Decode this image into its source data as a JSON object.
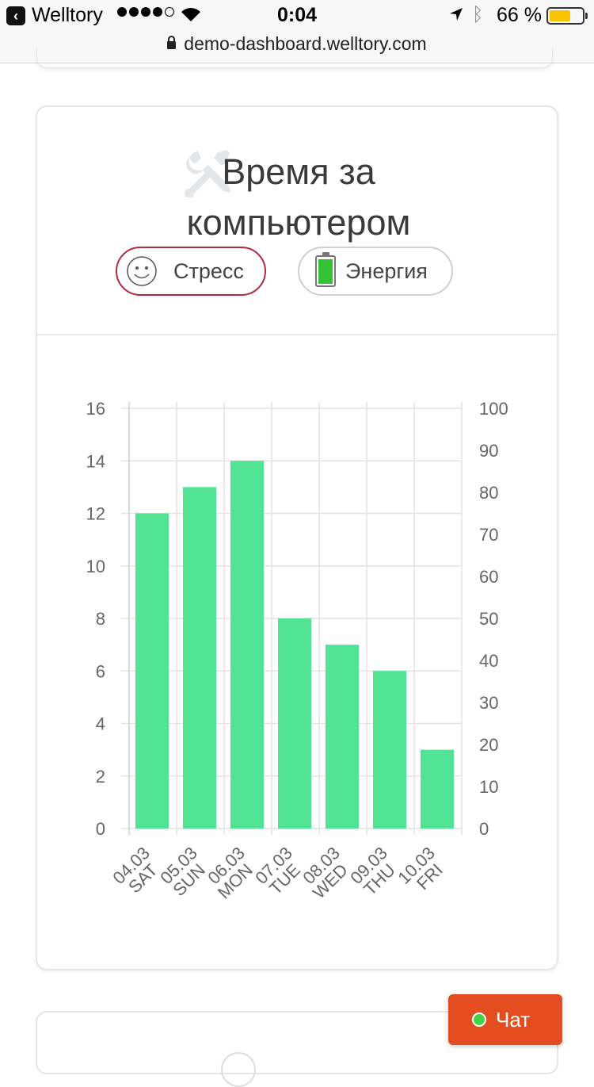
{
  "status_bar": {
    "back_app": "Welltory",
    "time": "0:04",
    "battery_percent": "66 %",
    "battery_level": 0.66
  },
  "url_bar": {
    "url": "demo-dashboard.welltory.com"
  },
  "card": {
    "title": "Время за компьютером",
    "buttons": {
      "stress": "Стресс",
      "energy": "Энергия"
    }
  },
  "chat_button": {
    "label": "Чат"
  },
  "colors": {
    "bar": "#52e294",
    "stress_border": "#b3283e",
    "chat": "#e44d1f"
  },
  "chart_data": {
    "type": "bar",
    "categories": [
      "04.03 SAT",
      "05.03 SUN",
      "06.03 MON",
      "07.03 TUE",
      "08.03 WED",
      "09.03 THU",
      "10.03 FRI"
    ],
    "tick_labels": [
      [
        "04.03",
        "SAT"
      ],
      [
        "05.03",
        "SUN"
      ],
      [
        "06.03",
        "MON"
      ],
      [
        "07.03",
        "TUE"
      ],
      [
        "08.03",
        "WED"
      ],
      [
        "09.03",
        "THU"
      ],
      [
        "10.03",
        "FRI"
      ]
    ],
    "values": [
      12,
      13,
      14,
      8,
      7,
      6,
      3
    ],
    "ylim": [
      0,
      16
    ],
    "yticks": [
      0,
      2,
      4,
      6,
      8,
      10,
      12,
      14,
      16
    ],
    "y2lim": [
      0,
      100
    ],
    "y2ticks": [
      0,
      10,
      20,
      30,
      40,
      50,
      60,
      70,
      80,
      90,
      100
    ],
    "grid": true,
    "title": "",
    "xlabel": "",
    "ylabel": ""
  }
}
